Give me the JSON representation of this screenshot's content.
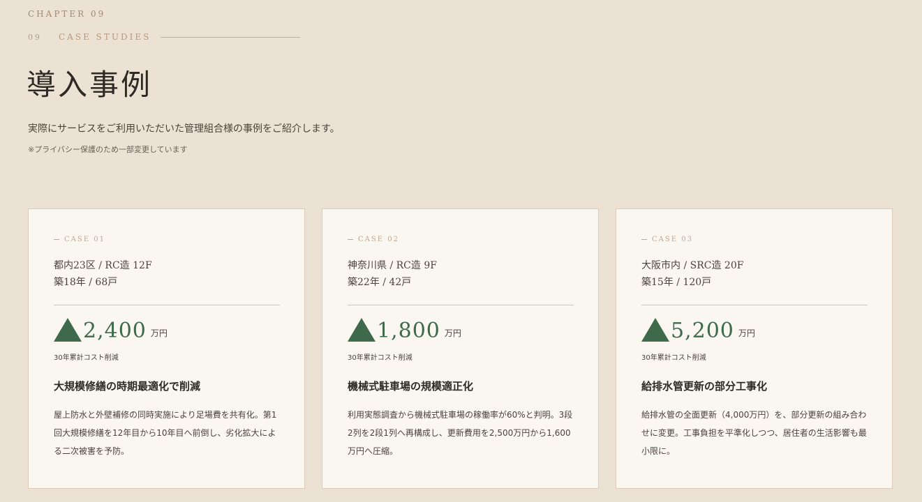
{
  "header": {
    "chapter": "CHAPTER 09",
    "section_number": "09",
    "section_label": "CASE STUDIES",
    "title": "導入事例",
    "lead": "実際にサービスをご利用いただいた管理組合様の事例をご紹介します。",
    "note": "※プライバシー保護のため一部変更しています"
  },
  "colors": {
    "background": "#ece2d3",
    "card": "#faf7f1",
    "accent_green": "#3e6a4b",
    "accent_gold": "#b4997f"
  },
  "cases": [
    {
      "label": "CASE 01",
      "location": "都内23区 / RC造 12F",
      "building": "築18年 / 68戸",
      "icon": "triangle-up-icon",
      "amount": "2,400",
      "unit": "万円",
      "caption": "30年累計コスト削減",
      "title": "大規模修繕の時期最適化で削減",
      "body": "屋上防水と外壁補修の同時実施により足場費を共有化。第1回大規模修繕を12年目から10年目へ前倒し、劣化拡大による二次被害を予防。"
    },
    {
      "label": "CASE 02",
      "location": "神奈川県 / RC造 9F",
      "building": "築22年 / 42戸",
      "icon": "triangle-up-icon",
      "amount": "1,800",
      "unit": "万円",
      "caption": "30年累計コスト削減",
      "title": "機械式駐車場の規模適正化",
      "body": "利用実態調査から機械式駐車場の稼働率が60%と判明。3段2列を2段1列へ再構成し、更新費用を2,500万円から1,600万円へ圧縮。"
    },
    {
      "label": "CASE 03",
      "location": "大阪市内 / SRC造 20F",
      "building": "築15年 / 120戸",
      "icon": "triangle-up-icon",
      "amount": "5,200",
      "unit": "万円",
      "caption": "30年累計コスト削減",
      "title": "給排水管更新の部分工事化",
      "body": "給排水管の全面更新（4,000万円）を、部分更新の組み合わせに変更。工事負担を平準化しつつ、居住者の生活影響も最小限に。"
    }
  ]
}
